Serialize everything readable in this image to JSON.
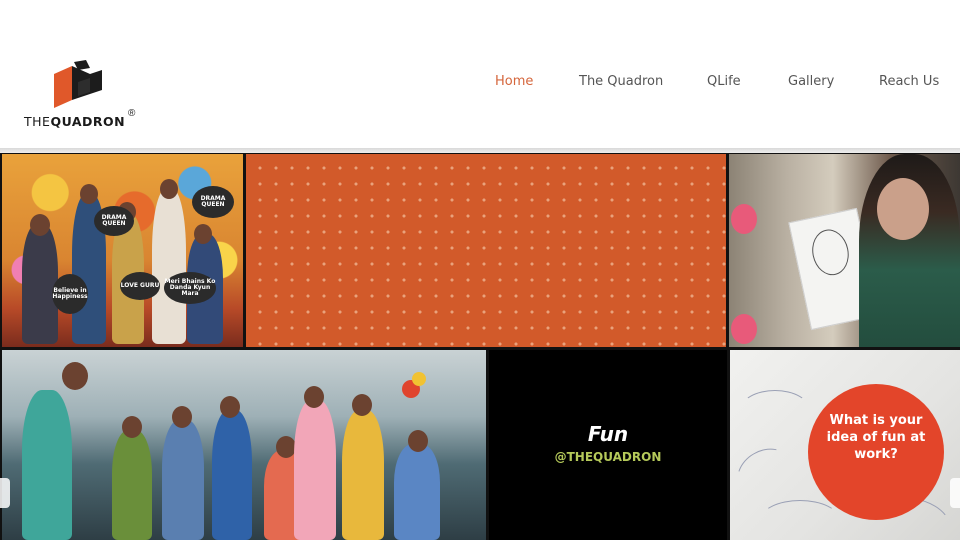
{
  "brand": {
    "name_part1": "THE",
    "name_part2": "QUADRON",
    "registered_mark": "®",
    "colors": {
      "orange": "#d5663c",
      "dark": "#1a1a1a"
    }
  },
  "nav": {
    "items": [
      {
        "label": "Home",
        "active": true
      },
      {
        "label": "The Quadron",
        "active": false
      },
      {
        "label": "QLife",
        "active": false
      },
      {
        "label": "Gallery",
        "active": false
      },
      {
        "label": "Reach Us",
        "active": false
      }
    ],
    "active_color": "#d5663c"
  },
  "tiles": {
    "group_signs": {
      "signs": [
        "DRAMA QUEEN",
        "DRAMA QUEEN",
        "LOVE GURU",
        "Believe in Happiness",
        "Meri Bhains Ko Danda Kyun Mara"
      ]
    },
    "fun": {
      "title": "Fun",
      "handle": "@THEQUADRON"
    },
    "whiteboard": {
      "text": "What is your idea of fun at work?"
    }
  }
}
